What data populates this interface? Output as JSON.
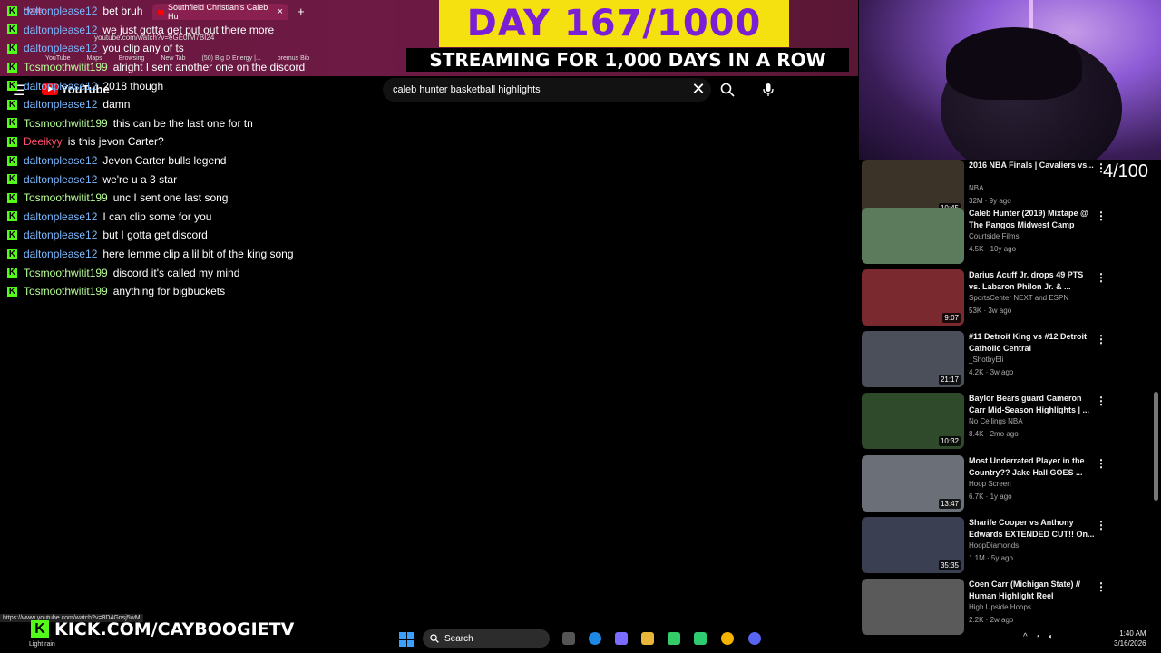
{
  "browser": {
    "tab_left_label": "Home",
    "active_tab_title": "Southfield Christian's Caleb Hu",
    "new_tab_label": "+",
    "url": "youtube.com/watch?v=eGE0fM7BI24",
    "bookmarks": [
      "YouTube",
      "Maps",
      "Browsing",
      "New Tab",
      "(50) Big D Energy |...",
      "oremus Bib"
    ]
  },
  "overlay": {
    "day_text": "DAY 167/1000",
    "streaming_text": "STREAMING FOR 1,000 DAYS IN A ROW",
    "counter": "4/100",
    "kick_url": "KICK.COM/CAYBOOGIETV"
  },
  "youtube": {
    "logo_text": "YouTube",
    "search_query": "caleb hunter basketball highlights"
  },
  "chat": [
    {
      "user": "daltonplease12",
      "msg": "bet bruh",
      "color": "blue"
    },
    {
      "user": "daltonplease12",
      "msg": "we just gotta get put out there more",
      "color": "blue"
    },
    {
      "user": "daltonplease12",
      "msg": "you clip any of ts",
      "color": "blue"
    },
    {
      "user": "Tosmoothwitit199",
      "msg": "alright I sent another one on the discord",
      "color": "green"
    },
    {
      "user": "daltonplease12",
      "msg": "2018 though",
      "color": "blue"
    },
    {
      "user": "daltonplease12",
      "msg": "damn",
      "color": "blue"
    },
    {
      "user": "Tosmoothwitit199",
      "msg": "this can be the last one for tn",
      "color": "green"
    },
    {
      "user": "Deeikyy",
      "msg": "is this jevon Carter?",
      "color": "red"
    },
    {
      "user": "daltonplease12",
      "msg": "Jevon Carter bulls legend",
      "color": "blue"
    },
    {
      "user": "daltonplease12",
      "msg": "we're u a 3 star",
      "color": "blue"
    },
    {
      "user": "Tosmoothwitit199",
      "msg": "unc I sent one last song",
      "color": "green"
    },
    {
      "user": "daltonplease12",
      "msg": "I can clip some for you",
      "color": "blue"
    },
    {
      "user": "daltonplease12",
      "msg": "but I gotta get discord",
      "color": "blue"
    },
    {
      "user": "daltonplease12",
      "msg": "here lemme clip a lil bit of the king song",
      "color": "blue"
    },
    {
      "user": "Tosmoothwitit199",
      "msg": "discord it's called my mind",
      "color": "green"
    },
    {
      "user": "Tosmoothwitit199",
      "msg": "anything for bigbuckets",
      "color": "green"
    }
  ],
  "videos": [
    {
      "title": "2016 NBA Finals | Cavaliers vs...",
      "channel": "NBA",
      "meta": "32M · 9y ago",
      "duration": "10:45",
      "thumb": "#3b3328"
    },
    {
      "title": "Caleb Hunter (2019) Mixtape @ The Pangos Midwest Camp",
      "channel": "Courtside Films",
      "meta": "4.5K · 10y ago",
      "duration": "",
      "thumb": "#5c7a5c"
    },
    {
      "title": "Darius Acuff Jr. drops 49 PTS vs. Labaron Philon Jr. & ...",
      "channel": "SportsCenter NEXT and ESPN",
      "meta": "53K · 3w ago",
      "duration": "9:07",
      "thumb": "#7a2a2f"
    },
    {
      "title": "#11 Detroit King vs #12 Detroit Catholic Central",
      "channel": "_ShotbyEli",
      "meta": "4.2K · 3w ago",
      "duration": "21:17",
      "thumb": "#4a4f5a"
    },
    {
      "title": "Baylor Bears guard Cameron Carr Mid-Season Highlights | ...",
      "channel": "No Ceilings NBA",
      "meta": "8.4K · 2mo ago",
      "duration": "10:32",
      "thumb": "#2e4a2a"
    },
    {
      "title": "Most Underrated Player in the Country?? Jake Hall GOES ...",
      "channel": "Hoop Screen",
      "meta": "6.7K · 1y ago",
      "duration": "13:47",
      "thumb": "#6b6f78"
    },
    {
      "title": "Sharife Cooper vs Anthony Edwards EXTENDED CUT!! On...",
      "channel": "HoopDiamonds",
      "meta": "1.1M · 5y ago",
      "duration": "35:35",
      "thumb": "#3a3f52"
    },
    {
      "title": "Coen Carr (Michigan State) // Human Highlight Reel",
      "channel": "High Upside Hoops",
      "meta": "2.2K · 2w ago",
      "duration": "",
      "thumb": "#5a5a5a"
    }
  ],
  "status_url": "https://www.youtube.com/watch?v=8D4Gnsj5wM",
  "taskbar": {
    "weather": "Light rain",
    "search_label": "Search",
    "time": "1:40 AM",
    "date": "3/16/2026"
  },
  "colors": {
    "kick_green": "#53fc18",
    "banner_yellow": "#f5e10f",
    "banner_purple": "#7a1fd6",
    "user_blue": "#7ab8ff",
    "user_green": "#b9ff9a",
    "user_red": "#ff4d6d"
  }
}
